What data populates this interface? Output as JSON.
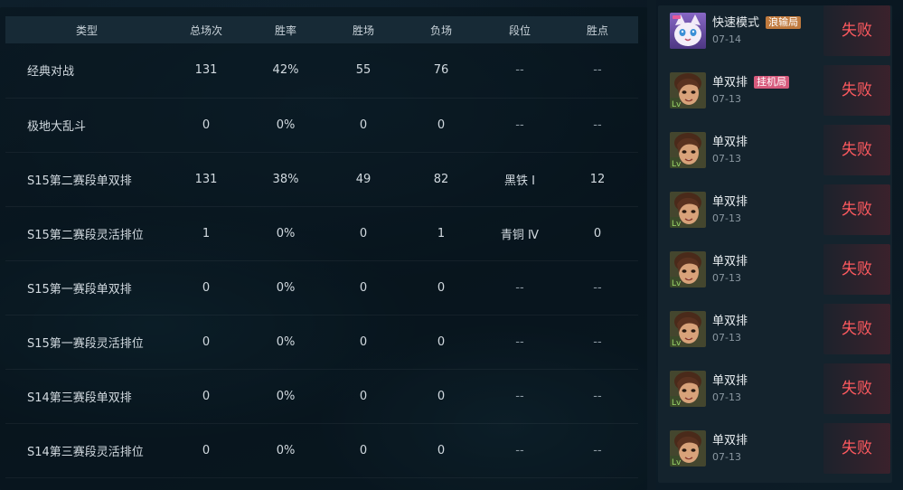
{
  "stats_table": {
    "columns": [
      "类型",
      "总场次",
      "胜率",
      "胜场",
      "负场",
      "段位",
      "胜点"
    ],
    "rows": [
      {
        "type": "经典对战",
        "total": "131",
        "winrate": "42%",
        "wins": "55",
        "losses": "76",
        "rank": "--",
        "lp": "--"
      },
      {
        "type": "极地大乱斗",
        "total": "0",
        "winrate": "0%",
        "wins": "0",
        "losses": "0",
        "rank": "--",
        "lp": "--"
      },
      {
        "type": "S15第二赛段单双排",
        "total": "131",
        "winrate": "38%",
        "wins": "49",
        "losses": "82",
        "rank": "黑铁 Ⅰ",
        "lp": "12"
      },
      {
        "type": "S15第二赛段灵活排位",
        "total": "1",
        "winrate": "0%",
        "wins": "0",
        "losses": "1",
        "rank": "青铜 Ⅳ",
        "lp": "0"
      },
      {
        "type": "S15第一赛段单双排",
        "total": "0",
        "winrate": "0%",
        "wins": "0",
        "losses": "0",
        "rank": "--",
        "lp": "--"
      },
      {
        "type": "S15第一赛段灵活排位",
        "total": "0",
        "winrate": "0%",
        "wins": "0",
        "losses": "0",
        "rank": "--",
        "lp": "--"
      },
      {
        "type": "S14第三赛段单双排",
        "total": "0",
        "winrate": "0%",
        "wins": "0",
        "losses": "0",
        "rank": "--",
        "lp": "--"
      },
      {
        "type": "S14第三赛段灵活排位",
        "total": "0",
        "winrate": "0%",
        "wins": "0",
        "losses": "0",
        "rank": "--",
        "lp": "--"
      }
    ]
  },
  "match_history": {
    "items": [
      {
        "mode": "快速模式",
        "tag": "浪输局",
        "tag_color": "#c07a3e",
        "date": "07-14",
        "result": "失败",
        "champion_icon": "yuumi-cat-champion-icon"
      },
      {
        "mode": "单双排",
        "tag": "挂机局",
        "tag_color": "#d65a7c",
        "date": "07-13",
        "result": "失败",
        "champion_icon": "taliyah-champion-icon"
      },
      {
        "mode": "单双排",
        "tag": "",
        "date": "07-13",
        "result": "失败",
        "champion_icon": "taliyah-champion-icon"
      },
      {
        "mode": "单双排",
        "tag": "",
        "date": "07-13",
        "result": "失败",
        "champion_icon": "taliyah-champion-icon"
      },
      {
        "mode": "单双排",
        "tag": "",
        "date": "07-13",
        "result": "失败",
        "champion_icon": "taliyah-champion-icon"
      },
      {
        "mode": "单双排",
        "tag": "",
        "date": "07-13",
        "result": "失败",
        "champion_icon": "taliyah-champion-icon"
      },
      {
        "mode": "单双排",
        "tag": "",
        "date": "07-13",
        "result": "失败",
        "champion_icon": "taliyah-champion-icon"
      },
      {
        "mode": "单双排",
        "tag": "",
        "date": "07-13",
        "result": "失败",
        "champion_icon": "taliyah-champion-icon"
      }
    ]
  },
  "colors": {
    "loss_text": "#ff5a5f",
    "header_bg": "#172a36",
    "panel_bg": "#14232d"
  }
}
